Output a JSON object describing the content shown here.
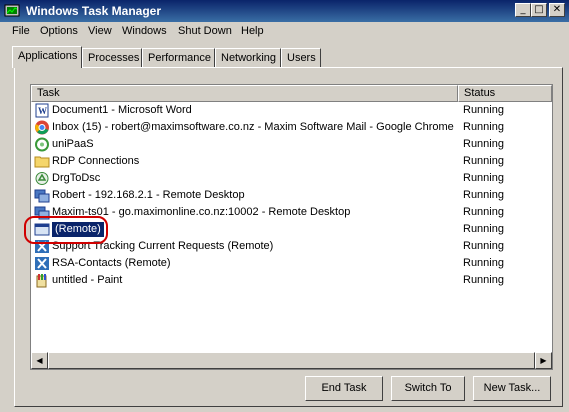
{
  "window": {
    "title": "Windows Task Manager",
    "minimize_glyph": "_",
    "maximize_glyph": "□",
    "close_glyph": "✕"
  },
  "menu": [
    "File",
    "Options",
    "View",
    "Windows",
    "Shut Down",
    "Help"
  ],
  "tabs": [
    {
      "label": "Applications",
      "active": true
    },
    {
      "label": "Processes",
      "active": false
    },
    {
      "label": "Performance",
      "active": false
    },
    {
      "label": "Networking",
      "active": false
    },
    {
      "label": "Users",
      "active": false
    }
  ],
  "list": {
    "columns": [
      "Task",
      "Status"
    ],
    "rows": [
      {
        "task": "Document1 - Microsoft Word",
        "status": "Running",
        "icon": "word-icon"
      },
      {
        "task": "Inbox (15) - robert@maximsoftware.co.nz - Maxim Software Mail - Google Chrome",
        "status": "Running",
        "icon": "chrome-icon"
      },
      {
        "task": "uniPaaS",
        "status": "Running",
        "icon": "unipaas-icon"
      },
      {
        "task": "RDP Connections",
        "status": "Running",
        "icon": "folder-icon"
      },
      {
        "task": "DrgToDsc",
        "status": "Running",
        "icon": "recycle-icon"
      },
      {
        "task": "Robert - 192.168.2.1 - Remote Desktop",
        "status": "Running",
        "icon": "remote-desktop-icon"
      },
      {
        "task": "Maxim-ts01 - go.maximonline.co.nz:10002 - Remote Desktop",
        "status": "Running",
        "icon": "remote-desktop-icon"
      },
      {
        "task": "(Remote)",
        "status": "Running",
        "icon": "window-icon",
        "selected": true
      },
      {
        "task": "Support Tracking Current Requests (Remote)",
        "status": "Running",
        "icon": "excel-x-icon"
      },
      {
        "task": "RSA-Contacts (Remote)",
        "status": "Running",
        "icon": "excel-x-icon"
      },
      {
        "task": "untitled - Paint",
        "status": "Running",
        "icon": "paint-icon"
      }
    ]
  },
  "scrollbar": {
    "left_arrow": "◀",
    "right_arrow": "▶"
  },
  "buttons": {
    "end_task": "End Task",
    "switch_to": "Switch To",
    "new_task": "New Task..."
  }
}
